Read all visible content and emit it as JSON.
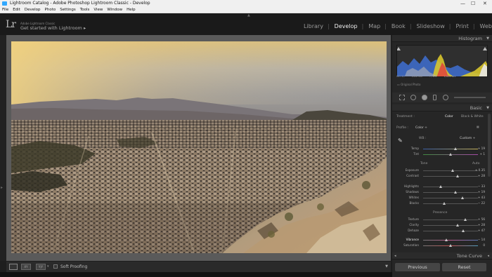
{
  "window": {
    "title": "Lightroom Catalog - Adobe Photoshop Lightroom Classic - Develop",
    "min": "—",
    "max": "☐",
    "close": "✕"
  },
  "menu": [
    "File",
    "Edit",
    "Develop",
    "Photo",
    "Settings",
    "Tools",
    "View",
    "Window",
    "Help"
  ],
  "identity": {
    "logo": "Lr",
    "small": "Adobe Lightroom Classic",
    "main": "Get started with Lightroom ▸"
  },
  "modules": {
    "library": "Library",
    "develop": "Develop",
    "map": "Map",
    "book": "Book",
    "slideshow": "Slideshow",
    "print": "Print",
    "web": "Web"
  },
  "histogram": {
    "title": "Histogram",
    "iso": "ISO 50",
    "focal": "4.04 mm",
    "aperture": "f / 2.0",
    "shutter": "1/400 sec",
    "original": "Original Photo"
  },
  "basic": {
    "title": "Basic",
    "treatment_label": "Treatment :",
    "treatment_color": "Color",
    "treatment_bw": "Black & White",
    "profile_label": "Profile :",
    "profile_value": "Color ÷",
    "wb_label": "WB :",
    "wb_value": "Custom ÷",
    "tone_label": "Tone",
    "auto_label": "Auto",
    "presence_label": "Presence"
  },
  "sliders": {
    "temp": {
      "label": "Temp",
      "value": "+ 19",
      "pos": 0.6
    },
    "tint": {
      "label": "Tint",
      "value": "+ 1",
      "pos": 0.5
    },
    "exposure": {
      "label": "Exposure",
      "value": "+ 0.35",
      "pos": 0.55
    },
    "contrast": {
      "label": "Contrast",
      "value": "+ 28",
      "pos": 0.64
    },
    "highlights": {
      "label": "Highlights",
      "value": "− 33",
      "pos": 0.33
    },
    "shadows": {
      "label": "Shadows",
      "value": "+ 19",
      "pos": 0.6
    },
    "whites": {
      "label": "Whites",
      "value": "+ 43",
      "pos": 0.72
    },
    "blacks": {
      "label": "Blacks",
      "value": "− 22",
      "pos": 0.39
    },
    "texture": {
      "label": "Texture",
      "value": "+ 56",
      "pos": 0.78
    },
    "clarity": {
      "label": "Clarity",
      "value": "+ 28",
      "pos": 0.64
    },
    "dehaze": {
      "label": "Dehaze",
      "value": "+ 47",
      "pos": 0.74
    },
    "vibrance": {
      "label": "Vibrance",
      "value": "− 14",
      "pos": 0.43
    },
    "saturation": {
      "label": "Saturation",
      "value": "0",
      "pos": 0.5
    }
  },
  "tonecurve": {
    "title": "Tone Curve"
  },
  "buttons": {
    "previous": "Previous",
    "reset": "Reset"
  },
  "toolbar": {
    "soft_proofing": "Soft Proofing",
    "view2": "XY",
    "view3": "Y|Y"
  },
  "colors": {
    "accent": "#31a8ff",
    "panel": "#262626"
  }
}
